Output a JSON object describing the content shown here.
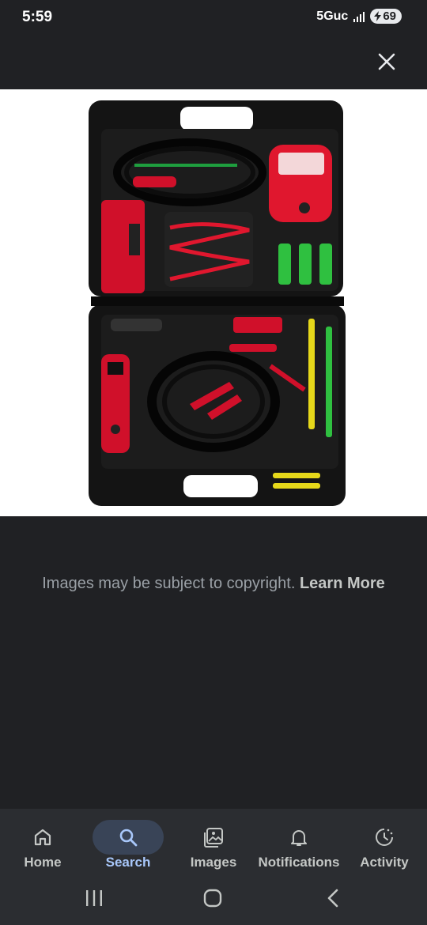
{
  "status": {
    "time": "5:59",
    "network": "5Guc",
    "battery": "69"
  },
  "image": {
    "icon": "tool-kit-photo"
  },
  "copyright": {
    "text": "Images may be subject to copyright.",
    "link": "Learn More"
  },
  "nav": {
    "items": [
      {
        "label": "Home",
        "icon": "home-icon"
      },
      {
        "label": "Search",
        "icon": "search-icon",
        "active": true
      },
      {
        "label": "Images",
        "icon": "images-icon"
      },
      {
        "label": "Notifications",
        "icon": "bell-icon"
      },
      {
        "label": "Activity",
        "icon": "activity-icon"
      }
    ]
  },
  "colors": {
    "background": "#202124",
    "nav_background": "#2b2d31",
    "accent": "#a8c7fa"
  }
}
